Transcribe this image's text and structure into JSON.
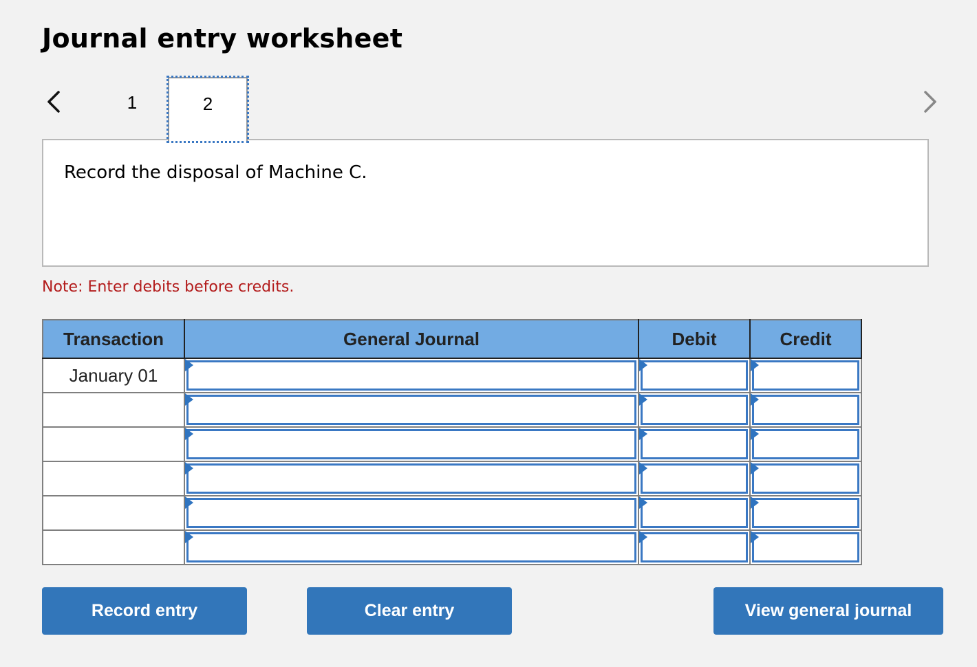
{
  "header": {
    "title": "Journal entry worksheet"
  },
  "navigation": {
    "prev_icon": "chevron-left-icon",
    "next_icon": "chevron-right-icon",
    "tabs": [
      {
        "label": "1",
        "active": false
      },
      {
        "label": "2",
        "active": true
      }
    ]
  },
  "question": {
    "text": "Record the disposal of Machine C."
  },
  "note": {
    "text": "Note: Enter debits before credits.",
    "color": "#b31b1b"
  },
  "journal": {
    "columns": [
      "Transaction",
      "General Journal",
      "Debit",
      "Credit"
    ],
    "rows": [
      {
        "transaction": "January 01",
        "account": "",
        "debit": "",
        "credit": ""
      },
      {
        "transaction": "",
        "account": "",
        "debit": "",
        "credit": ""
      },
      {
        "transaction": "",
        "account": "",
        "debit": "",
        "credit": ""
      },
      {
        "transaction": "",
        "account": "",
        "debit": "",
        "credit": ""
      },
      {
        "transaction": "",
        "account": "",
        "debit": "",
        "credit": ""
      },
      {
        "transaction": "",
        "account": "",
        "debit": "",
        "credit": ""
      }
    ],
    "header_color": "#72abe3",
    "input_border_color": "#3a78c3"
  },
  "buttons": {
    "record": "Record entry",
    "clear": "Clear entry",
    "view": "View general journal",
    "color": "#3276ba"
  }
}
